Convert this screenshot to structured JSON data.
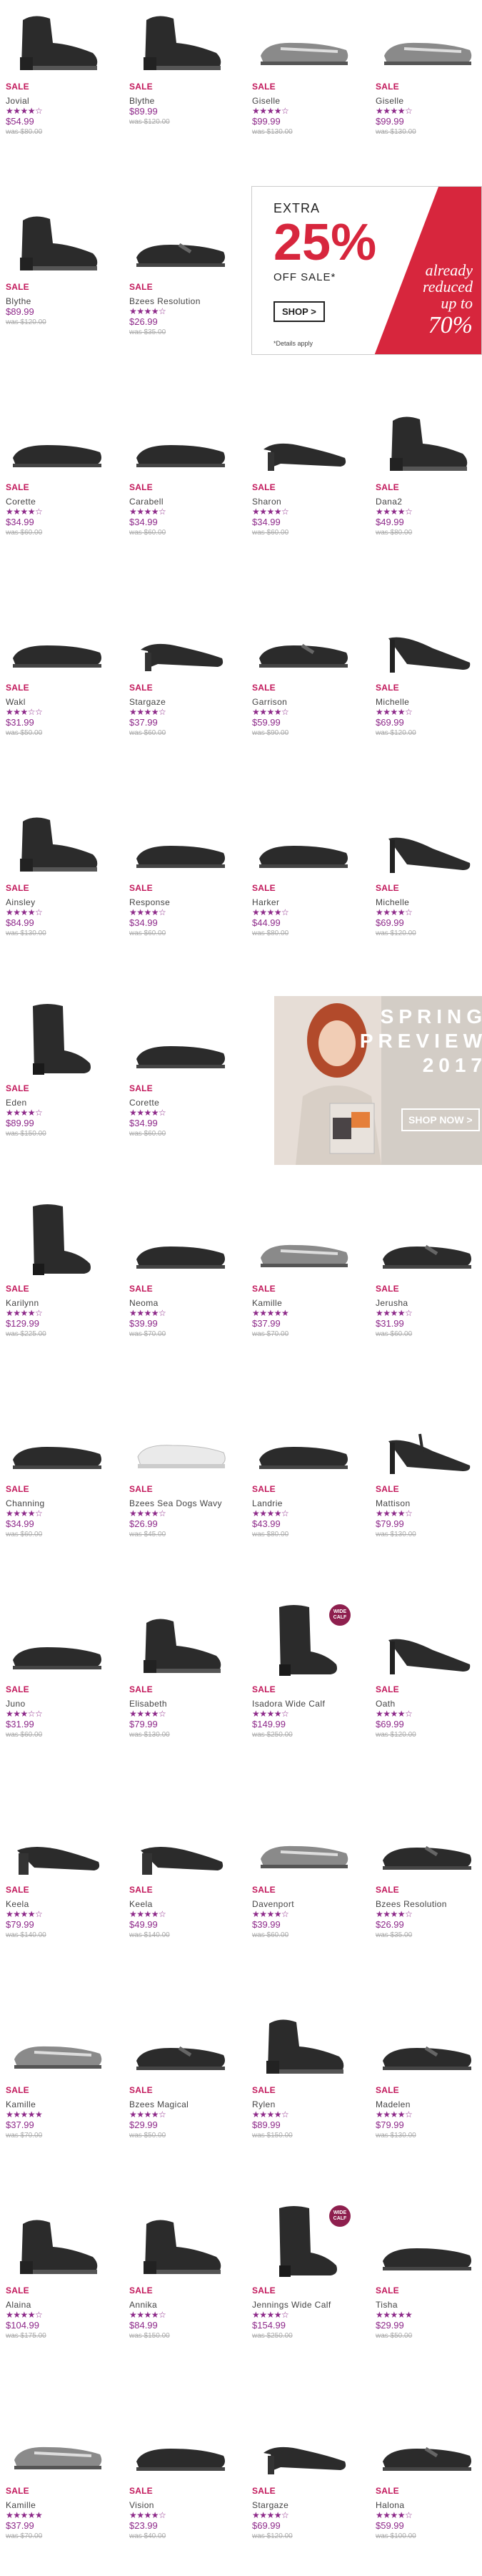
{
  "sale_label": "SALE",
  "promo": {
    "extra": "EXTRA",
    "percent": "25%",
    "off": "OFF SALE",
    "asterisk": "*",
    "shop_button": "SHOP >",
    "note": "*Details apply",
    "line1": "already",
    "line2": "reduced",
    "line3": "up to",
    "big": "70%",
    "accent_color": "#d7263d"
  },
  "spring": {
    "title1": "SPRING",
    "title2": "PREVIEW",
    "title3": "2017",
    "button": "SHOP NOW >"
  },
  "wide_badge_text": "WIDE CALF",
  "products": [
    {
      "name": "Jovial",
      "stars": "★★★★☆",
      "price": "$54.99",
      "was": "was $80.00",
      "shape": "bootie"
    },
    {
      "name": "Blythe",
      "stars": "",
      "price": "$89.99",
      "was": "was $120.00",
      "shape": "bootie"
    },
    {
      "name": "Giselle",
      "stars": "★★★★☆",
      "price": "$99.99",
      "was": "was $130.00",
      "shape": "loafer"
    },
    {
      "name": "Giselle",
      "stars": "★★★★☆",
      "price": "$99.99",
      "was": "was $130.00",
      "shape": "loafer"
    },
    {
      "name": "Blythe",
      "stars": "",
      "price": "$89.99",
      "was": "was $120.00",
      "shape": "bootie"
    },
    {
      "name": "Bzees Resolution",
      "stars": "★★★★☆",
      "price": "$26.99",
      "was": "was $35.00",
      "shape": "mary"
    },
    {
      "name": "Corette",
      "stars": "★★★★☆",
      "price": "$34.99",
      "was": "was $60.00",
      "shape": "flat"
    },
    {
      "name": "Carabell",
      "stars": "★★★★☆",
      "price": "$34.99",
      "was": "was $60.00",
      "shape": "flat"
    },
    {
      "name": "Sharon",
      "stars": "★★★★☆",
      "price": "$34.99",
      "was": "was $60.00",
      "shape": "pump"
    },
    {
      "name": "Dana2",
      "stars": "★★★★☆",
      "price": "$49.99",
      "was": "was $80.00",
      "shape": "bootie"
    },
    {
      "name": "Wakl",
      "stars": "★★★☆☆",
      "price": "$31.99",
      "was": "was $50.00",
      "shape": "flat"
    },
    {
      "name": "Stargaze",
      "stars": "★★★★☆",
      "price": "$37.99",
      "was": "was $60.00",
      "shape": "pump"
    },
    {
      "name": "Garrison",
      "stars": "★★★★☆",
      "price": "$59.99",
      "was": "was $90.00",
      "shape": "mary"
    },
    {
      "name": "Michelle",
      "stars": "★★★★☆",
      "price": "$69.99",
      "was": "was $120.00",
      "shape": "heel"
    },
    {
      "name": "Ainsley",
      "stars": "★★★★☆",
      "price": "$84.99",
      "was": "was $130.00",
      "shape": "bootie"
    },
    {
      "name": "Response",
      "stars": "★★★★☆",
      "price": "$34.99",
      "was": "was $60.00",
      "shape": "flat"
    },
    {
      "name": "Harker",
      "stars": "★★★★☆",
      "price": "$44.99",
      "was": "was $80.00",
      "shape": "flat"
    },
    {
      "name": "Michelle",
      "stars": "★★★★☆",
      "price": "$69.99",
      "was": "was $120.00",
      "shape": "heel"
    },
    {
      "name": "Eden",
      "stars": "★★★★☆",
      "price": "$89.99",
      "was": "was $150.00",
      "shape": "tallboot"
    },
    {
      "name": "Corette",
      "stars": "★★★★☆",
      "price": "$34.99",
      "was": "was $60.00",
      "shape": "flat"
    },
    {
      "name": "Karilynn",
      "stars": "★★★★☆",
      "price": "$129.99",
      "was": "was $225.00",
      "shape": "tallboot"
    },
    {
      "name": "Neoma",
      "stars": "★★★★☆",
      "price": "$39.99",
      "was": "was $70.00",
      "shape": "flat"
    },
    {
      "name": "Kamille",
      "stars": "★★★★★",
      "price": "$37.99",
      "was": "was $70.00",
      "shape": "loafer"
    },
    {
      "name": "Jerusha",
      "stars": "★★★★☆",
      "price": "$31.99",
      "was": "was $60.00",
      "shape": "mary"
    },
    {
      "name": "Channing",
      "stars": "★★★★☆",
      "price": "$34.99",
      "was": "was $60.00",
      "shape": "flat"
    },
    {
      "name": "Bzees Sea Dogs Wavy",
      "stars": "★★★★☆",
      "price": "$26.99",
      "was": "was $45.00",
      "shape": "sneaker"
    },
    {
      "name": "Landrie",
      "stars": "★★★★☆",
      "price": "$43.99",
      "was": "was $80.00",
      "shape": "flat"
    },
    {
      "name": "Mattison",
      "stars": "★★★★☆",
      "price": "$79.99",
      "was": "was $130.00",
      "shape": "tstrap"
    },
    {
      "name": "Juno",
      "stars": "★★★☆☆",
      "price": "$31.99",
      "was": "was $60.00",
      "shape": "flat"
    },
    {
      "name": "Elisabeth",
      "stars": "★★★★☆",
      "price": "$79.99",
      "was": "was $130.00",
      "shape": "bootie"
    },
    {
      "name": "Isadora Wide Calf",
      "stars": "★★★★☆",
      "price": "$149.99",
      "was": "was $250.00",
      "shape": "tallboot",
      "wide": true
    },
    {
      "name": "Oath",
      "stars": "★★★★☆",
      "price": "$69.99",
      "was": "was $120.00",
      "shape": "heel"
    },
    {
      "name": "Keela",
      "stars": "★★★★☆",
      "price": "$79.99",
      "was": "was $140.00",
      "shape": "block"
    },
    {
      "name": "Keela",
      "stars": "★★★★☆",
      "price": "$49.99",
      "was": "was $140.00",
      "shape": "block"
    },
    {
      "name": "Davenport",
      "stars": "★★★★☆",
      "price": "$39.99",
      "was": "was $60.00",
      "shape": "loafer"
    },
    {
      "name": "Bzees Resolution",
      "stars": "★★★★☆",
      "price": "$26.99",
      "was": "was $35.00",
      "shape": "mary"
    },
    {
      "name": "Kamille",
      "stars": "★★★★★",
      "price": "$37.99",
      "was": "was $70.00",
      "shape": "loafer"
    },
    {
      "name": "Bzees Magical",
      "stars": "★★★★☆",
      "price": "$29.99",
      "was": "was $50.00",
      "shape": "mary"
    },
    {
      "name": "Rylen",
      "stars": "★★★★☆",
      "price": "$89.99",
      "was": "was $150.00",
      "shape": "bootie"
    },
    {
      "name": "Madelen",
      "stars": "★★★★☆",
      "price": "$79.99",
      "was": "was $130.00",
      "shape": "mary"
    },
    {
      "name": "Alaina",
      "stars": "★★★★☆",
      "price": "$104.99",
      "was": "was $175.00",
      "shape": "bootie"
    },
    {
      "name": "Annika",
      "stars": "★★★★☆",
      "price": "$84.99",
      "was": "was $150.00",
      "shape": "bootie"
    },
    {
      "name": "Jennings Wide Calf",
      "stars": "★★★★☆",
      "price": "$154.99",
      "was": "was $250.00",
      "shape": "tallboot",
      "wide": true
    },
    {
      "name": "Tisha",
      "stars": "★★★★★",
      "price": "$29.99",
      "was": "was $50.00",
      "shape": "flat"
    },
    {
      "name": "Kamille",
      "stars": "★★★★★",
      "price": "$37.99",
      "was": "was $70.00",
      "shape": "loafer"
    },
    {
      "name": "Vision",
      "stars": "★★★★☆",
      "price": "$23.99",
      "was": "was $40.00",
      "shape": "flat"
    },
    {
      "name": "Stargaze",
      "stars": "★★★★☆",
      "price": "$69.99",
      "was": "was $120.00",
      "shape": "pump"
    },
    {
      "name": "Halona",
      "stars": "★★★★☆",
      "price": "$59.99",
      "was": "was $100.00",
      "shape": "mary"
    }
  ]
}
